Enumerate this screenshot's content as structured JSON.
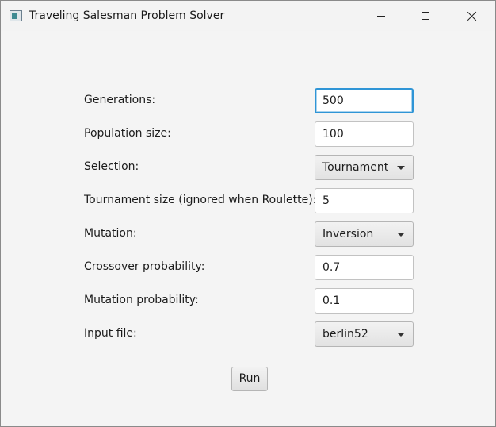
{
  "window": {
    "title": "Traveling Salesman Problem Solver",
    "icons": {
      "app": "app-window-icon",
      "minimize": "minimize-icon",
      "maximize": "maximize-icon",
      "close": "close-icon"
    }
  },
  "form": {
    "generations": {
      "label": "Generations:",
      "value": "500"
    },
    "population_size": {
      "label": "Population size:",
      "value": "100"
    },
    "selection": {
      "label": "Selection:",
      "value": "Tournament"
    },
    "tournament_size": {
      "label": "Tournament size (ignored when Roulette):",
      "value": "5"
    },
    "mutation": {
      "label": "Mutation:",
      "value": "Inversion"
    },
    "crossover_probability": {
      "label": "Crossover probability:",
      "value": "0.7"
    },
    "mutation_probability": {
      "label": "Mutation probability:",
      "value": "0.1"
    },
    "input_file": {
      "label": "Input file:",
      "value": "berlin52"
    }
  },
  "actions": {
    "run_label": "Run"
  },
  "colors": {
    "focus_border": "#2f95d6",
    "background": "#f4f4f4"
  }
}
